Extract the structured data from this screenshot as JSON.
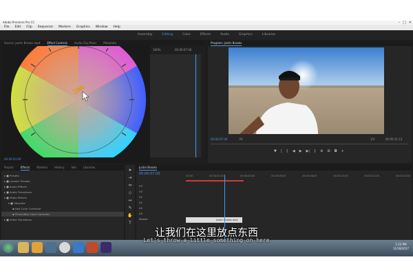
{
  "window": {
    "title": "Adobe Premiere Pro CC",
    "controls": [
      "–",
      "□",
      "✕"
    ]
  },
  "menu": [
    "File",
    "Edit",
    "Clip",
    "Sequence",
    "Markers",
    "Graphics",
    "Window",
    "Help"
  ],
  "workspaces": {
    "items": [
      "Assembly",
      "Editing",
      "Color",
      "Effects",
      "Audio",
      "Graphics",
      "Libraries"
    ],
    "active_index": 1
  },
  "source_panel": {
    "tabs": [
      "Source: Justin Brooks.mp4",
      "Effect Controls",
      "Audio Clip Mixer",
      "Metadata"
    ],
    "active_tab": 1,
    "zoom": "100%",
    "timecode_left": "00:00:03:00",
    "timecode_right": "00:00:07:00"
  },
  "program_panel": {
    "title": "Program: Justin Brooks",
    "timecode": "00:00:07:00",
    "fit": "Fit",
    "duration": "00:00:11:13",
    "quality": "1/2"
  },
  "project_panel": {
    "tabs": [
      "Project",
      "Effects",
      "Markers",
      "History",
      "Info",
      "Libraries"
    ],
    "active_tab": 1,
    "items": [
      "Presets",
      "Lumetri Presets",
      "Audio Effects",
      "Audio Transitions",
      "Video Effects",
      "Obsolete",
      "Fast Color Corrector",
      "Three-Way Color Corrector",
      "Video Transitions"
    ]
  },
  "timeline": {
    "title": "Justin Brooks",
    "timecode": "00:00:07:00",
    "ruler": [
      "00:00",
      "00:00:02:00",
      "00:00:04:00",
      "00:00:06:00",
      "00:00:08:00",
      "00:00:10:00",
      "00:00:12:00",
      "00:00:14:00"
    ],
    "tracks": [
      "V3",
      "V2",
      "V1",
      "A1",
      "A2",
      "A3",
      "Master"
    ],
    "clip_label": "Justin Brooks.mp4"
  },
  "taskbar": {
    "time": "1:23 PM",
    "date": "11/18/2017"
  },
  "subtitles": {
    "cn": "让我们在这里放点东西",
    "en": "Let's throw a little something on here"
  },
  "colors": {
    "accent": "#4d8fe6",
    "playhead": "#3aa0ff",
    "panel_bg": "#262626"
  }
}
